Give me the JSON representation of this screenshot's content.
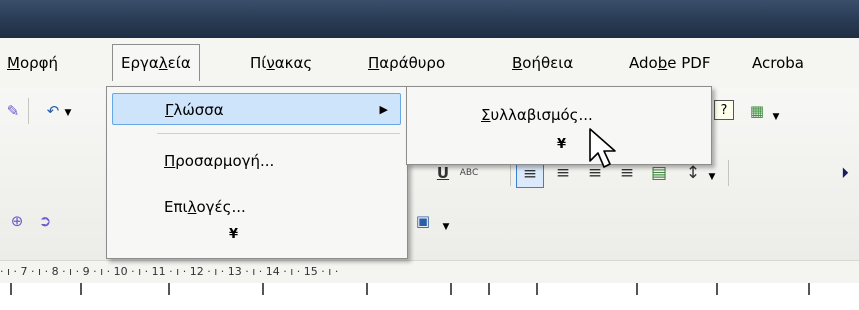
{
  "menubar": {
    "items": [
      {
        "pre": "",
        "acc": "Μ",
        "post": "ορφή"
      },
      {
        "pre": "Εργα",
        "acc": "λ",
        "post": "εία"
      },
      {
        "pre": "Πί",
        "acc": "ν",
        "post": "ακας"
      },
      {
        "pre": "",
        "acc": "Π",
        "post": "αράθυρο"
      },
      {
        "pre": "",
        "acc": "Β",
        "post": "οήθεια"
      },
      {
        "pre": "Ado",
        "acc": "b",
        "post": "e PDF"
      },
      {
        "pre": "Acroba",
        "acc": "",
        "post": ""
      }
    ]
  },
  "tools_menu": {
    "items": [
      {
        "pre": "",
        "acc": "Γ",
        "post": "λώσσα",
        "submenu_arrow": "▶"
      },
      {
        "pre": "",
        "acc": "Π",
        "post": "ροσαρμογή..."
      },
      {
        "pre": "Επι",
        "acc": "λ",
        "post": "ογές..."
      }
    ],
    "expand_glyph": "¥"
  },
  "language_submenu": {
    "items": [
      {
        "pre": "",
        "acc": "Σ",
        "post": "υλλαβισμός..."
      }
    ],
    "expand_glyph": "¥"
  },
  "ruler": {
    "text": "· ı · 7 · ı · 8 · ı · 9 · ı · 10 · ı · 11 · ı · 12 · ı · 13 · ı · 14 · ı · 15 · ı ·"
  },
  "toolbar": {
    "undo_icon": "undo-icon",
    "help_icon": "help-icon",
    "active_align": "left",
    "accent_color": "#3c7fd1"
  }
}
